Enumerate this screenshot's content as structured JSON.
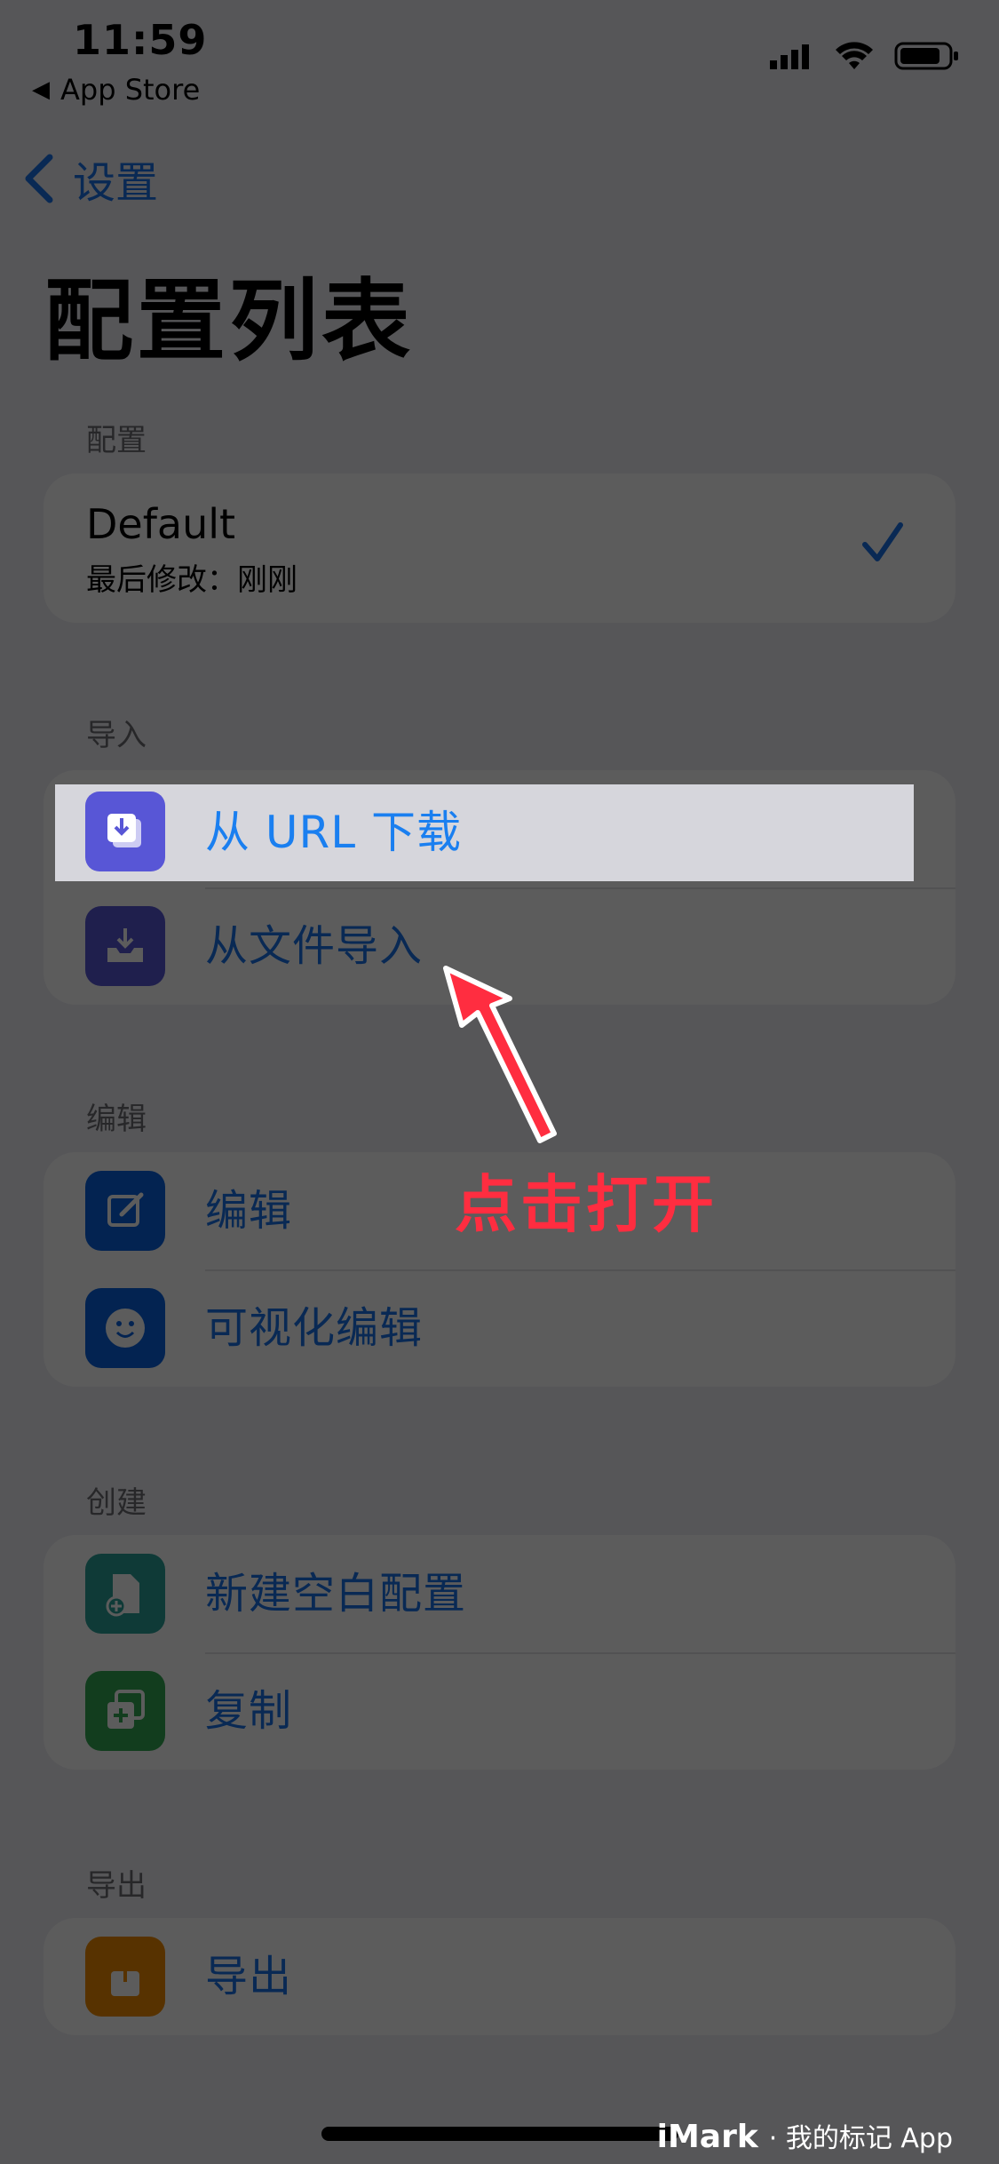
{
  "status_bar": {
    "time": "11:59",
    "back_app": "App Store"
  },
  "nav": {
    "back_label": "设置",
    "title": "配置列表"
  },
  "sections": {
    "config": {
      "header": "配置",
      "item": {
        "title": "Default",
        "subtitle": "最后修改：刚刚"
      }
    },
    "import": {
      "header": "导入",
      "items": [
        {
          "label": "从 URL 下载",
          "icon": "download-tray-icon",
          "color": "#5856d6"
        },
        {
          "label": "从文件导入",
          "icon": "tray-import-icon",
          "color": "#5856d6"
        }
      ]
    },
    "edit": {
      "header": "编辑",
      "items": [
        {
          "label": "编辑",
          "icon": "square-pencil-icon",
          "color": "#0a63e0"
        },
        {
          "label": "可视化编辑",
          "icon": "smiley-face-icon",
          "color": "#0a63e0"
        }
      ]
    },
    "create": {
      "header": "创建",
      "items": [
        {
          "label": "新建空白配置",
          "icon": "new-document-icon",
          "color": "#2aa198"
        },
        {
          "label": "复制",
          "icon": "duplicate-icon",
          "color": "#34a853"
        }
      ]
    },
    "export": {
      "header": "导出",
      "items": [
        {
          "label": "导出",
          "icon": "share-icon",
          "color": "#f28c00"
        }
      ]
    }
  },
  "annotation": {
    "callout": "点击打开"
  },
  "watermark": {
    "brand": "iMark",
    "text": "· 我的标记 App"
  },
  "colors": {
    "accent": "#1a73e8",
    "callout": "#ff2d40",
    "dim_overlay": "rgba(0,0,0,0.64)"
  }
}
